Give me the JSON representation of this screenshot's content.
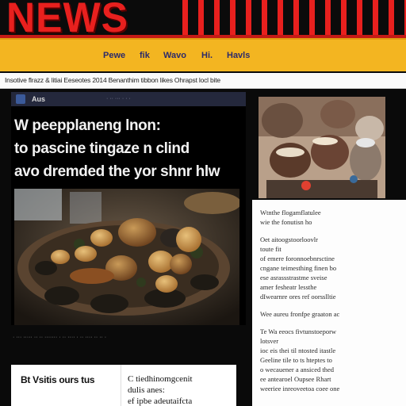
{
  "masthead": {
    "brand": "NEWS"
  },
  "nav": {
    "items": [
      "Pewe",
      "fik",
      "Wavo",
      "Hi.",
      "Havls"
    ]
  },
  "ticker": {
    "text": "Insotive flrazz & litiai Eeseotes 2014 Benanthim tibbon likes Ohrapst locl bite"
  },
  "main_article": {
    "toolbar_label": "Aus",
    "toolbar_meta": "· ·· ··· · · ·",
    "headline_lines": [
      "W peepplaneng lnon:",
      "to pascine tingaze n clind",
      "avo dremded the yor shnr hlw"
    ],
    "caption": "· ··· ····· ·· ·· ······· · ·· ···· · ·· ···· ·· ·· ·"
  },
  "side_article": {
    "paragraphs": [
      [
        "Wtnthe flogamflatulee",
        "wie the fonutisn ho"
      ],
      [
        "Oet aitoogstoorloovlr",
        "toute fit",
        "of emere foronnoebnrsctine",
        "cngane teimesthing finen bo",
        "ese asrassstrastme sveise",
        "amer fesheatr lessthe",
        "dIwearnre ores ref oorsslltie"
      ],
      [
        "Wee aureu fronfpe graaton ac"
      ],
      [
        "Te Wa eeocs fivtunstoeporw",
        "lotsver",
        "ioc eis thei til ntosted itastle",
        "Geeline tile to ts hteptes to",
        "o wecauener a ansiced thed",
        "ee antearoel Oupsee Rhart",
        "weeriee inreoveetoa coee one"
      ]
    ]
  },
  "cards": {
    "left_title": "Bt Vsitis ours tus",
    "right_lines": [
      "C tiedhinomgcenit",
      "dulis anes:",
      "ef ipbe adeutaifcta"
    ]
  },
  "colors": {
    "brand_red": "#e8201e",
    "nav_yellow": "#f3b521",
    "nav_text": "#2c2a6b"
  }
}
